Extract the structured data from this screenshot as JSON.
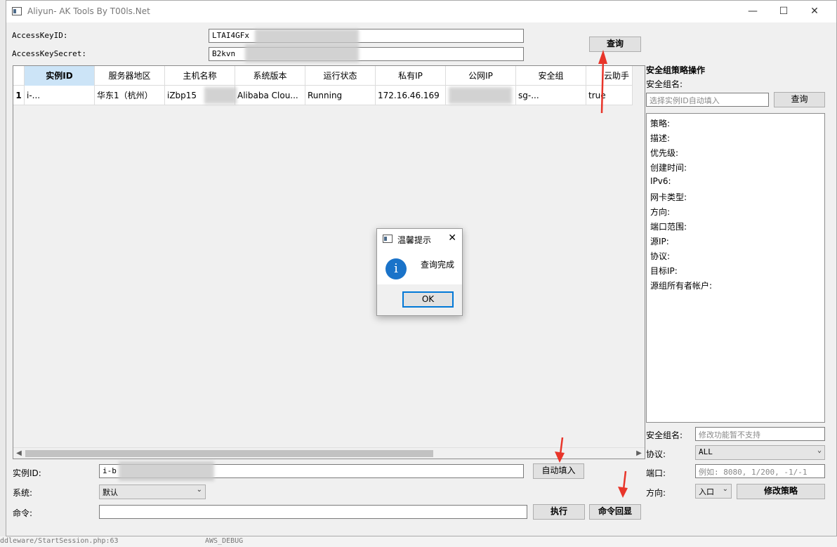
{
  "window": {
    "title": "Aliyun- AK Tools By T00ls.Net",
    "minimize": "—",
    "maximize": "☐",
    "close": "✕"
  },
  "credentials": {
    "key_id_label": "AccessKeyID:",
    "key_id_value": "LTAI4GFx",
    "key_secret_label": "AccessKeySecret:",
    "key_secret_value": "B2kvn",
    "query_button": "查询"
  },
  "table": {
    "columns": [
      "实例ID",
      "服务器地区",
      "主机名称",
      "系统版本",
      "运行状态",
      "私有IP",
      "公网IP",
      "安全组",
      "云助手"
    ],
    "rows": [
      {
        "index": "1",
        "cells": [
          "i-...",
          "华东1（杭州）",
          "iZbp15",
          "Alibaba Clou...",
          "Running",
          "172.16.46.169",
          "",
          "sg-...",
          "true"
        ]
      }
    ]
  },
  "bottom": {
    "instance_label": "实例ID:",
    "instance_value": "i-b",
    "autofill_button": "自动填入",
    "system_label": "系统:",
    "system_value": "默认",
    "command_label": "命令:",
    "command_value": "",
    "execute_button": "执行",
    "echo_button": "命令回显"
  },
  "security": {
    "title": "安全组策略操作",
    "group_name_label": "安全组名:",
    "instance_placeholder": "选择实例ID自动填入",
    "query_button": "查询",
    "fields": [
      "策略:",
      "描述:",
      "优先级:",
      "创建时间:",
      "IPv6:",
      "网卡类型:",
      "方向:",
      "端口范围:",
      "源IP:",
      "协议:",
      "目标IP:",
      "源组所有者帐户:"
    ],
    "edit_group_label": "安全组名:",
    "edit_group_placeholder": "修改功能暂不支持",
    "protocol_label": "协议:",
    "protocol_value": "ALL",
    "port_label": "端口:",
    "port_placeholder": "例如: 8080, 1/200, -1/-1",
    "direction_label": "方向:",
    "direction_value": "入口",
    "modify_button": "修改策略"
  },
  "dialog": {
    "title": "温馨提示",
    "message": "查询完成",
    "ok_button": "OK",
    "close": "✕"
  },
  "background": {
    "bottom_text": "ddleware/StartSession.php:63",
    "bottom_text2": "AWS_DEBUG"
  },
  "colors": {
    "arrow": "#e8352a",
    "selected_header": "#cce4f7",
    "info_icon": "#1a73c9",
    "focus_border": "#0078d7"
  }
}
